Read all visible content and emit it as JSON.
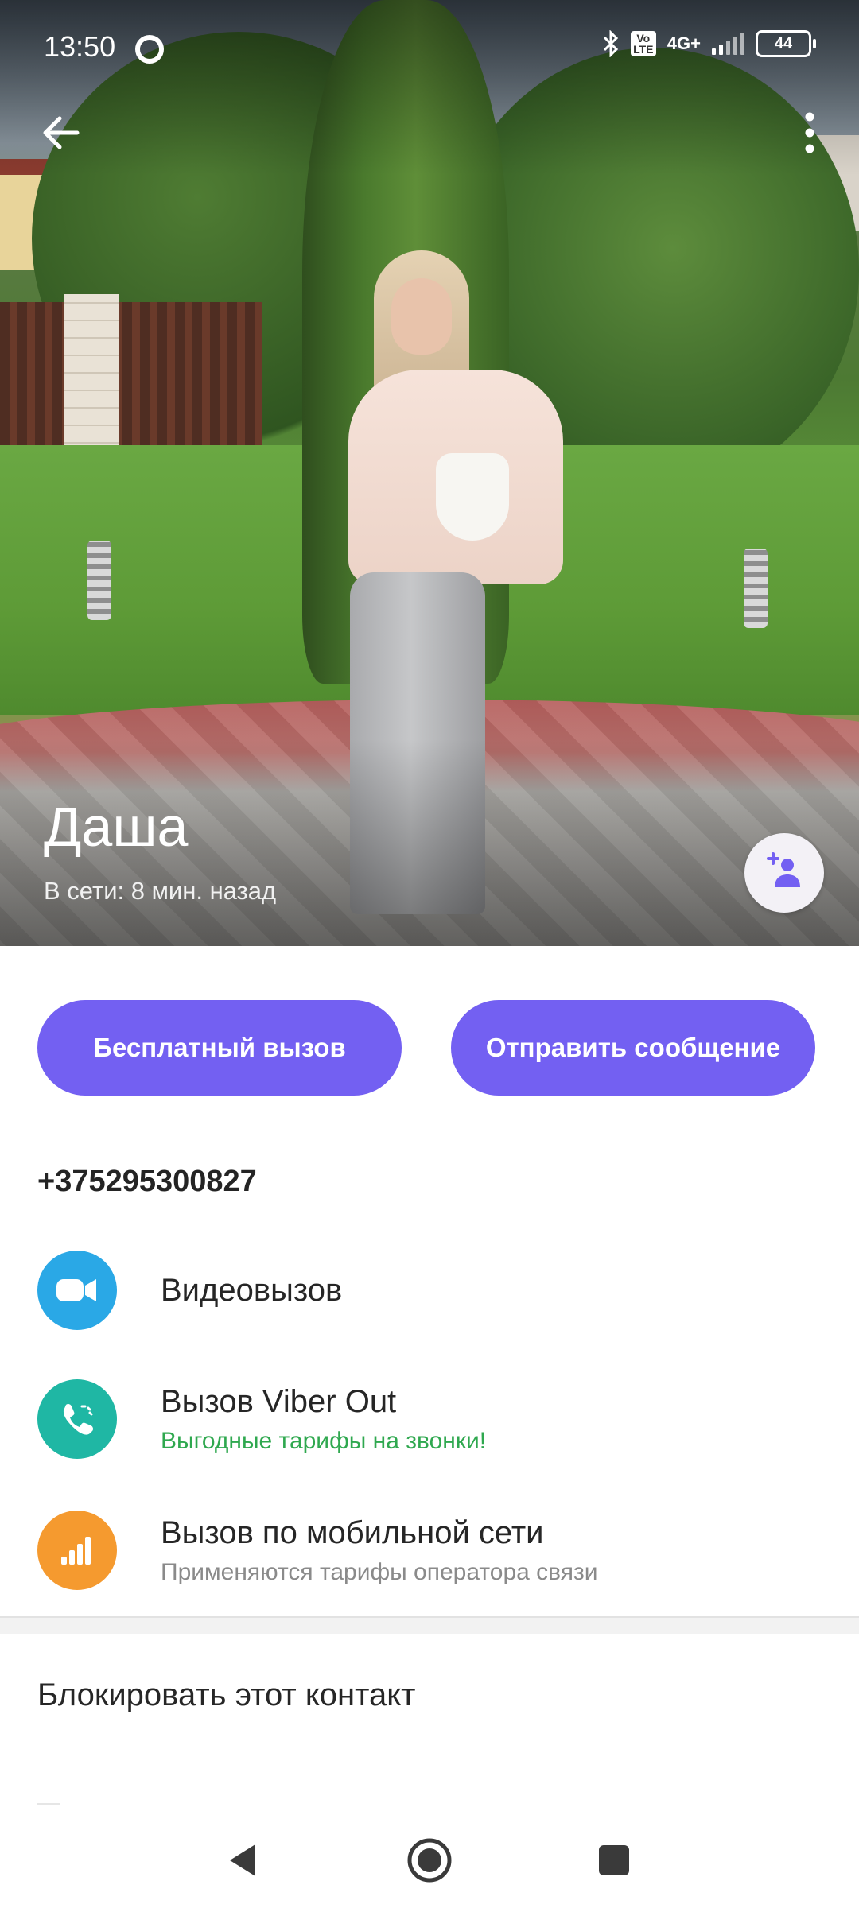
{
  "status_bar": {
    "time": "13:50",
    "network": "4G+",
    "volte": "Vo LTE",
    "battery": "44"
  },
  "contact": {
    "name": "Даша",
    "last_seen": "В сети: 8 мин. назад",
    "phone": "+375295300827"
  },
  "actions": {
    "free_call": "Бесплатный вызов",
    "send_message": "Отправить сообщение"
  },
  "call_options": [
    {
      "title": "Видеовызов",
      "subtitle": "",
      "color": "#2aa8e6"
    },
    {
      "title": "Вызов Viber Out",
      "subtitle": "Выгодные тарифы на звонки!",
      "color": "#1fb7a4",
      "subtitle_color": "#2fa84f"
    },
    {
      "title": "Вызов по мобильной сети",
      "subtitle": "Применяются тарифы оператора связи",
      "color": "#f59a2f",
      "subtitle_color": "#8a8a8a"
    }
  ],
  "block_contact": "Блокировать этот контакт",
  "colors": {
    "accent": "#7360f2"
  },
  "icons": {
    "back": "arrow-left-icon",
    "more": "more-vertical-icon",
    "add_contact": "add-person-icon",
    "video": "video-camera-icon",
    "viber_out": "phone-icon",
    "mobile": "signal-bars-icon",
    "nav_back": "triangle-back-icon",
    "nav_home": "circle-home-icon",
    "nav_recent": "square-recent-icon"
  }
}
